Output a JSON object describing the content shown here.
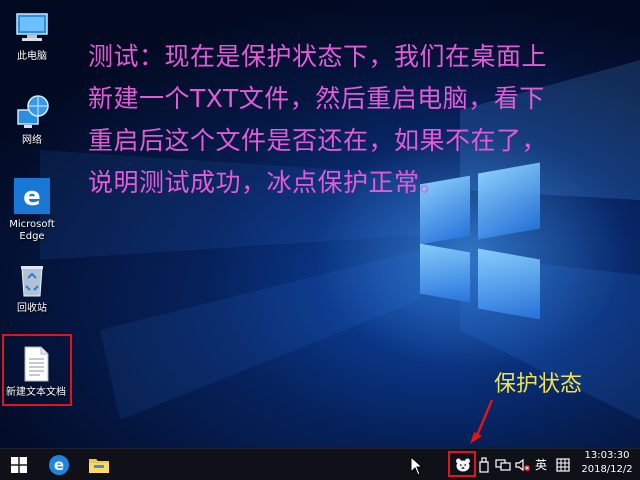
{
  "desktop": {
    "icons": [
      {
        "label": "此电脑",
        "icon": "computer-icon"
      },
      {
        "label": "网络",
        "icon": "network-icon"
      },
      {
        "label_line1": "Microsoft",
        "label_line2": "Edge",
        "icon": "edge-icon"
      },
      {
        "label": "回收站",
        "icon": "recycle-bin-icon"
      },
      {
        "label": "新建文本文档",
        "icon": "text-file-icon"
      }
    ]
  },
  "annotation": {
    "lines": [
      "测试：现在是保护状态下，我们在桌面上",
      "新建一个TXT文件，然后重启电脑，看下",
      "重启后这个文件是否还在，如果不在了，",
      "说明测试成功，冰点保护正常。"
    ],
    "status_label": "保护状态",
    "text_color": "#e35bd8",
    "status_color": "#f2e44a",
    "highlight_color": "#e0141a"
  },
  "taskbar": {
    "start_icon": "windows-start-icon",
    "pinned": [
      "edge-icon",
      "file-explorer-icon"
    ],
    "tray": {
      "icons": [
        "deep-freeze-bear-icon",
        "usb-drive-icon",
        "network-tray-icon",
        "volume-muted-icon",
        "ime-mode-icon"
      ],
      "ime_label": "英"
    },
    "clock": {
      "time": "13:03:30",
      "date": "2018/12/2"
    }
  }
}
